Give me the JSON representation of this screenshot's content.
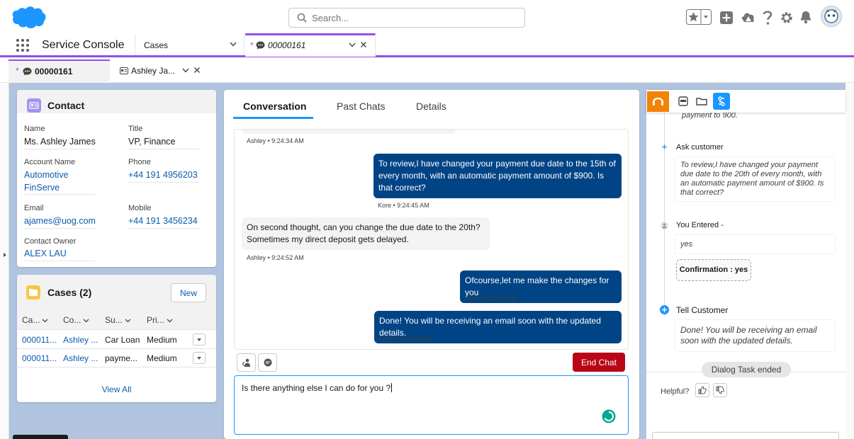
{
  "header": {
    "search_placeholder": "Search...",
    "colors": {
      "brand": "#1b96ff",
      "accent_purple": "#9050e9"
    }
  },
  "nav": {
    "app_name": "Service Console",
    "cases_tab": "Cases",
    "record_tab": {
      "dirty_marker": "*",
      "label": "00000161"
    }
  },
  "subtabs": {
    "active": {
      "dirty_marker": "*",
      "label": "00000161"
    },
    "second": {
      "label": "Ashley Ja..."
    }
  },
  "contact": {
    "title": "Contact",
    "name_label": "Name",
    "name": "Ms. Ashley James",
    "title_label": "Title",
    "title_value": "VP, Finance",
    "account_label": "Account Name",
    "account_line1": "Automotive",
    "account_line2": "FinServe",
    "phone_label": "Phone",
    "phone": "+44 191 4956203",
    "email_label": "Email",
    "email": "ajames@uog.com",
    "mobile_label": "Mobile",
    "mobile": "+44 191 3456234",
    "owner_label": "Contact Owner",
    "owner": "ALEX LAU"
  },
  "cases": {
    "title": "Cases (2)",
    "new_button": "New",
    "columns": [
      "Ca...",
      "Co...",
      "Su...",
      "Pri..."
    ],
    "rows": [
      {
        "case": "000011...",
        "contact": "Ashley ...",
        "subject": "Car Loan",
        "priority": "Medium"
      },
      {
        "case": "000011...",
        "contact": "Ashley ...",
        "subject": "payme...",
        "priority": "Medium"
      }
    ],
    "view_all": "View All"
  },
  "conversation": {
    "tabs": [
      "Conversation",
      "Past Chats",
      "Details"
    ],
    "messages": [
      {
        "stamp": "Ashley • 9:24:34 AM"
      },
      {
        "text": "To review,I have changed your payment due date to the 15th of every month, with an automatic payment amount of $900. Is that correct?",
        "stamp": "Kore • 9:24:45 AM"
      },
      {
        "text": "On second thought, can you change the due date to the 20th? Sometimes my direct deposit gets delayed.",
        "stamp": "Ashley • 9:24:52 AM"
      },
      {
        "text": "Ofcourse,let me make the changes for you",
        "stamp": "Kore • 9:25:08 AM"
      },
      {
        "text": "Done! You will be receiving an email soon with the updated details.",
        "stamp": "Kore • 9:25:38 AM"
      }
    ],
    "end_chat": "End Chat",
    "draft": "Is there anything else I can do for you ?"
  },
  "assist": {
    "top_cut_text": "payment to 900.",
    "ask_customer": "Ask customer",
    "ask_text": "To review,I have changed your payment due date to the 20th of every month, with an automatic payment amount of $900. Is that correct?",
    "you_entered": "You Entered -",
    "entered_value": "yes",
    "confirmation": "Confirmation : yes",
    "tell_customer": "Tell Customer",
    "tell_text": "Done! You will be receiving an email soon with the updated details.",
    "dialog_ended": "Dialog Task ended",
    "helpful": "Helpful?"
  }
}
